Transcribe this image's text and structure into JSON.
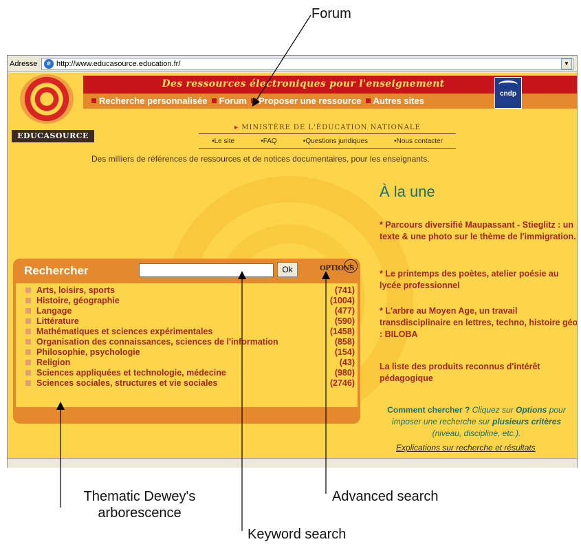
{
  "annotations": {
    "forum": "Forum",
    "thematic_line1": "Thematic Dewey's",
    "thematic_line2": "arborescence",
    "advanced": "Advanced search",
    "keyword": "Keyword search"
  },
  "browser": {
    "address_label": "Adresse",
    "url": "http://www.educasource.education.fr/"
  },
  "header": {
    "tagline": "Des ressources électroniques pour l'enseignement",
    "nav": [
      "Recherche personnalisée",
      "Forum",
      "Proposer une ressource",
      "Autres sites"
    ],
    "logo_text": "EDUCASOURCE",
    "cndp_label": "cndp",
    "ministry": "MINISTÈRE DE L'ÉDUCATION NATIONALE",
    "sublinks": [
      "•Le site",
      "•FAQ",
      "•Questions juridiques",
      "•Nous contacter"
    ],
    "intro": "Des milliers de références de ressources et de notices documentaires, pour les enseignants."
  },
  "search": {
    "label": "Rechercher",
    "input_value": "",
    "ok_label": "Ok",
    "options_label": "OPTIONS",
    "options_plus": "+"
  },
  "categories": [
    {
      "name": "Arts, loisirs, sports",
      "count": "(741)"
    },
    {
      "name": "Histoire, géographie",
      "count": "(1004)"
    },
    {
      "name": "Langage",
      "count": "(477)"
    },
    {
      "name": "Littérature",
      "count": "(590)"
    },
    {
      "name": "Mathématiques et sciences expérimentales",
      "count": "(1458)"
    },
    {
      "name": "Organisation des connaissances, sciences de l'information",
      "count": "(858)"
    },
    {
      "name": "Philosophie, psychologie",
      "count": "(154)"
    },
    {
      "name": "Religion",
      "count": "(43)"
    },
    {
      "name": "Sciences appliquées et technologie, médecine",
      "count": "(980)"
    },
    {
      "name": "Sciences sociales, structures et vie sociales",
      "count": "(2746)"
    }
  ],
  "news": {
    "title": "À la une",
    "items": [
      "* Parcours diversifié Maupassant - Stieglitz : un texte & une photo sur le thème de l'immigration.",
      "* Le printemps des poètes, atelier poésie au lycée professionnel",
      "* L'arbre au Moyen Age, un travail transdisciplinaire en lettres, techno, histoire géo : BILOBA",
      "La liste des produits reconnus d'intérêt pédagogique"
    ]
  },
  "howto": {
    "question": "Comment chercher ?",
    "text1": "Cliquez sur",
    "options_word": "Options",
    "text2": "pour imposer une recherche sur",
    "bold_words": "plusieurs critères",
    "text3": "(niveau, discipline, etc.).",
    "explanations": "Explications sur recherche et résultats"
  },
  "colors": {
    "page_bg": "#fcd54a",
    "red_band": "#c8151b",
    "orange_band": "#e58a2c",
    "category_text": "#a0281e",
    "teal_title": "#1f6e6a"
  }
}
